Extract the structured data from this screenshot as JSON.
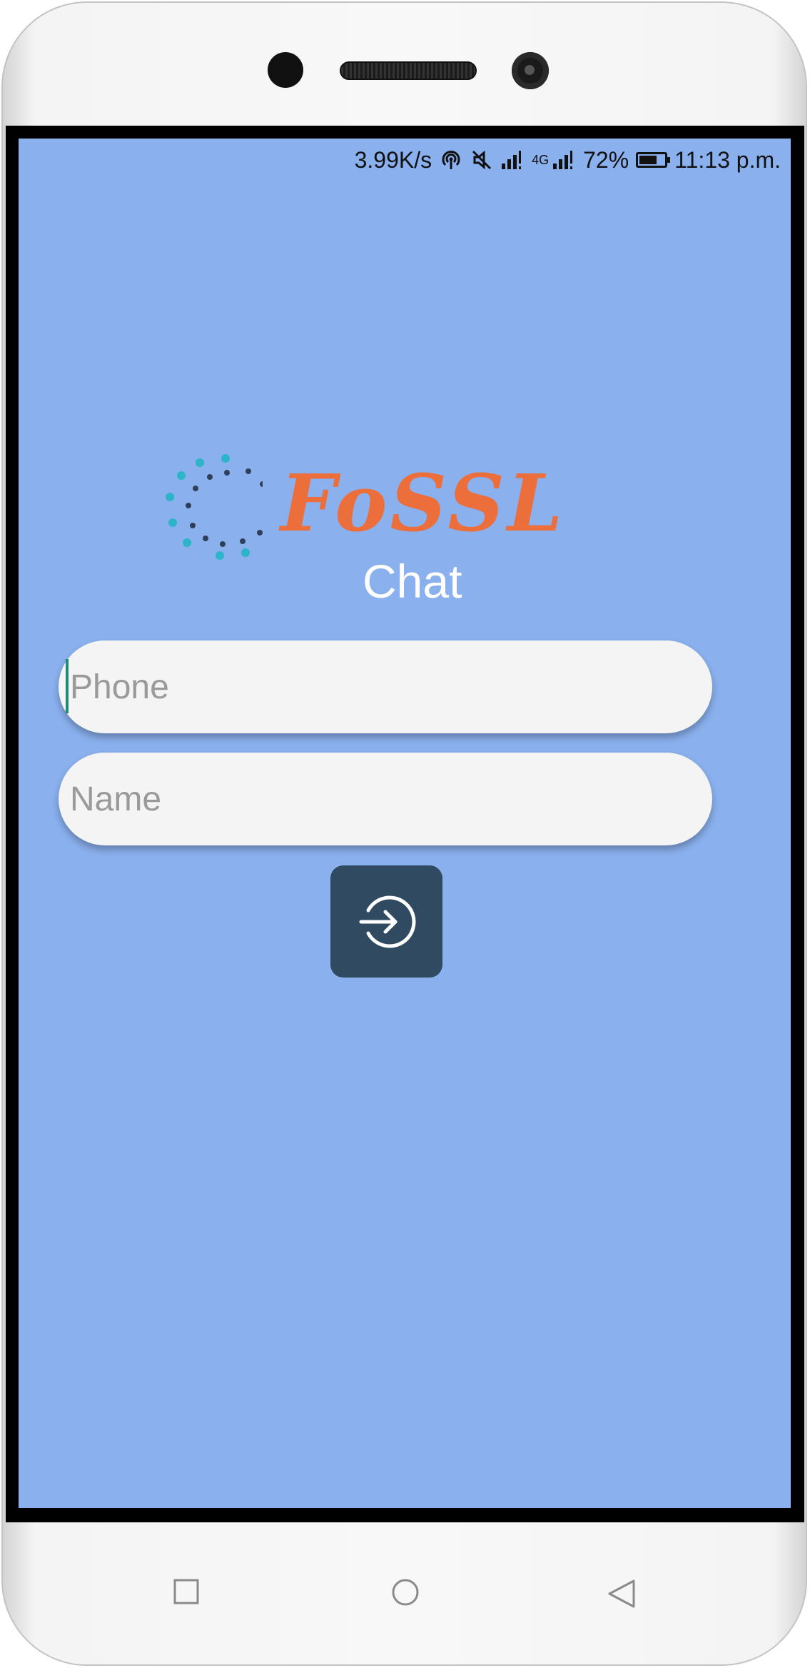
{
  "status_bar": {
    "speed": "3.99K/s",
    "network_small": "4G",
    "battery": "72%",
    "battery_level": 0.72,
    "time": "11:13 p.m."
  },
  "logo": {
    "title": "FoSSL",
    "subtitle": "Chat"
  },
  "form": {
    "phone_placeholder": "Phone",
    "phone_value": "",
    "name_placeholder": "Name",
    "name_value": ""
  },
  "login_button": {
    "icon": "login-arrow-icon"
  },
  "navigation": {
    "recent_icon": "square-icon",
    "home_icon": "circle-icon",
    "back_icon": "triangle-back-icon"
  },
  "colors": {
    "screen_background": "#8ab0ee",
    "logo_orange": "#ec6f3b",
    "button": "#2f4a61",
    "field": "#f4f4f4"
  }
}
